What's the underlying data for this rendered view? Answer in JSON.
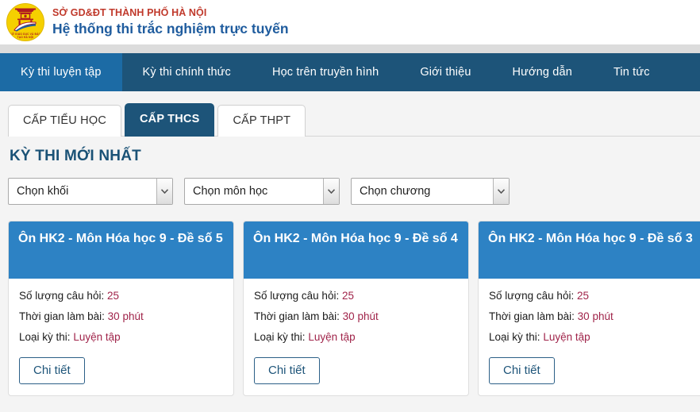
{
  "header": {
    "logo_icon": "hanoi-doet-emblem-icon",
    "logo_caption": "SỞ GIÁO DỤC VÀ ĐÀO TẠO HÀ NỘI",
    "subtitle": "SỞ GD&ĐT THÀNH PHỐ HÀ NỘI",
    "title": "Hệ thống thi trắc nghiệm trực tuyến",
    "subtitle_color": "#c0392b",
    "title_color": "#1f5c9e"
  },
  "nav": {
    "active_color": "#1c6ba5",
    "bar_color": "#1d5479",
    "items": [
      {
        "label": "Kỳ thi luyện tập",
        "active": true
      },
      {
        "label": "Kỳ thi chính thức",
        "active": false
      },
      {
        "label": "Học trên truyền hình",
        "active": false
      },
      {
        "label": "Giới thiệu",
        "active": false
      },
      {
        "label": "Hướng dẫn",
        "active": false
      },
      {
        "label": "Tin tức",
        "active": false
      }
    ]
  },
  "level_tabs": {
    "items": [
      {
        "label": "CẤP TIỂU HỌC",
        "active": false
      },
      {
        "label": "CẤP THCS",
        "active": true
      },
      {
        "label": "CẤP THPT",
        "active": false
      }
    ]
  },
  "main": {
    "section_title": "KỲ THI MỚI NHẤT",
    "section_title_color": "#1a5276",
    "filters": [
      {
        "name": "grade",
        "selected": "Chọn khối"
      },
      {
        "name": "subject",
        "selected": "Chọn môn học"
      },
      {
        "name": "chapter",
        "selected": "Chọn chương"
      }
    ],
    "card_labels": {
      "question_count": "Số lượng câu hỏi:",
      "duration": "Thời gian làm bài:",
      "exam_type": "Loại kỳ thi:",
      "detail_button": "Chi tiết"
    },
    "card_header_color": "#2d82c4",
    "card_value_color": "#a0244a",
    "cards": [
      {
        "title": "Ôn HK2 - Môn Hóa học 9 - Đề số 5",
        "question_count": "25",
        "duration": "30 phút",
        "exam_type": "Luyện tập"
      },
      {
        "title": "Ôn HK2 - Môn Hóa học 9 - Đề số 4",
        "question_count": "25",
        "duration": "30 phút",
        "exam_type": "Luyện tập"
      },
      {
        "title": "Ôn HK2 - Môn Hóa học 9 - Đề số 3",
        "question_count": "25",
        "duration": "30 phút",
        "exam_type": "Luyện tập"
      }
    ]
  }
}
